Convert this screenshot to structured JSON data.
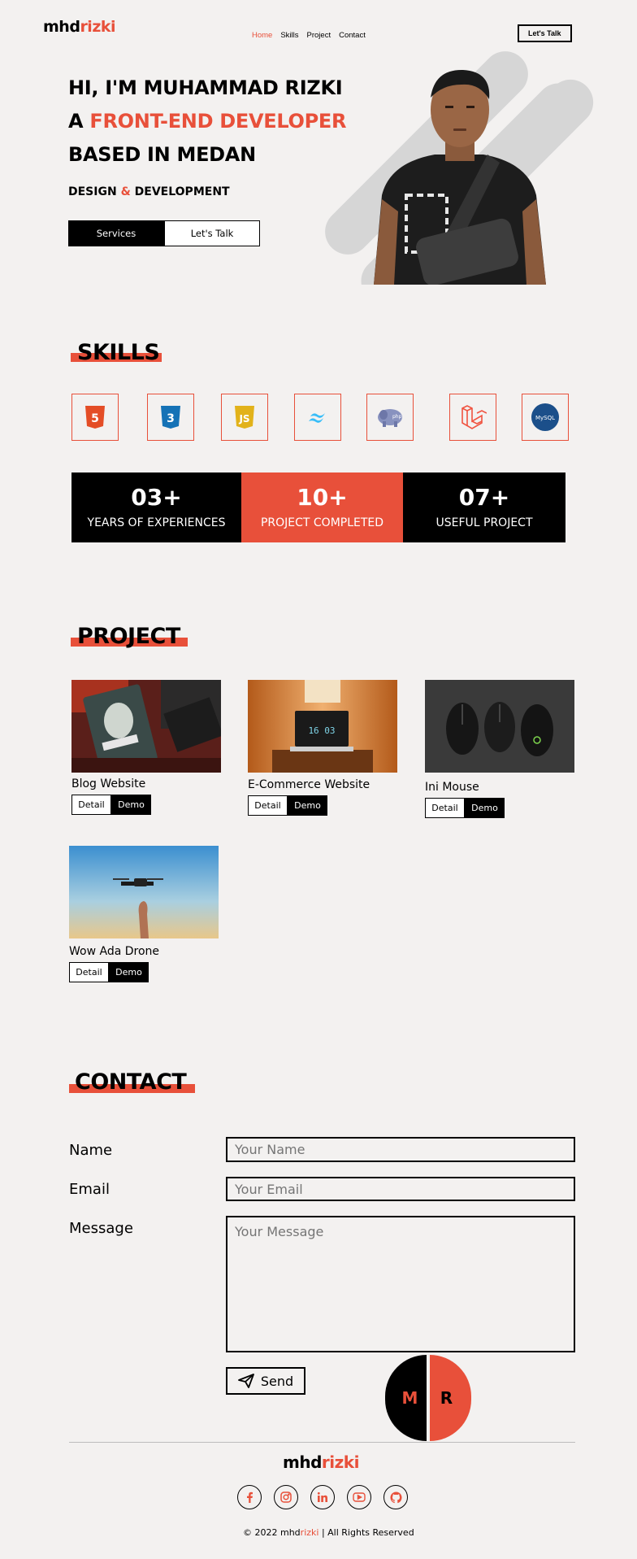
{
  "nav": {
    "logo_a": "mhd",
    "logo_b": "rizki",
    "links": [
      "Home",
      "Skills",
      "Project",
      "Contact"
    ],
    "cta": "Let's Talk"
  },
  "hero": {
    "line1": "HI, I'M MUHAMMAD RIZKI",
    "line2_a": "A ",
    "line2_b": "FRONT-END DEVELOPER",
    "line3": "BASED IN MEDAN",
    "tag_a": "DESIGN ",
    "tag_amp": "&",
    "tag_b": " DEVELOPMENT",
    "btn_services": "Services",
    "btn_talk": "Let's Talk"
  },
  "skills": {
    "title": "SKILLS",
    "icons": [
      "html5-icon",
      "css3-icon",
      "javascript-icon",
      "tailwind-icon",
      "php-icon",
      "laravel-icon",
      "mysql-icon"
    ],
    "stats": [
      {
        "num": "03+",
        "label": "YEARS OF EXPERIENCES"
      },
      {
        "num": "10+",
        "label": "PROJECT COMPLETED"
      },
      {
        "num": "07+",
        "label": "USEFUL PROJECT"
      }
    ]
  },
  "projects": {
    "title": "PROJECT",
    "items": [
      {
        "title": "Blog Website",
        "detail": "Detail",
        "demo": "Demo"
      },
      {
        "title": "E-Commerce Website",
        "detail": "Detail",
        "demo": "Demo"
      },
      {
        "title": "Ini Mouse",
        "detail": "Detail",
        "demo": "Demo"
      },
      {
        "title": "Wow Ada Drone",
        "detail": "Detail",
        "demo": "Demo"
      }
    ],
    "laptop_clock": "16 03"
  },
  "contact": {
    "title": "CONTACT",
    "name_label": "Name",
    "email_label": "Email",
    "message_label": "Message",
    "name_placeholder": "Your Name",
    "email_placeholder": "Your Email",
    "message_placeholder": "Your Message",
    "send": "Send",
    "mr_left": "M",
    "mr_right": "R"
  },
  "footer": {
    "logo_a": "mhd",
    "logo_b": "rizki",
    "socials": [
      "facebook-icon",
      "instagram-icon",
      "linkedin-icon",
      "youtube-icon",
      "github-icon"
    ],
    "copy_a": "© 2022 mhd",
    "copy_b": "rizki",
    "copy_c": " | All Rights Reserved"
  },
  "colors": {
    "accent": "#e8503a",
    "background": "#f3f1f0",
    "dark": "#000000"
  }
}
